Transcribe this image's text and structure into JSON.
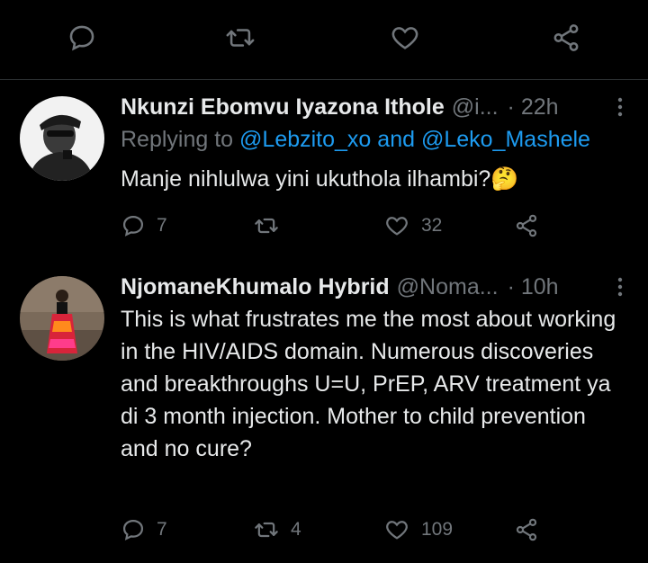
{
  "top_actions": {
    "icons": [
      "reply-icon",
      "retweet-icon",
      "like-icon",
      "share-icon"
    ]
  },
  "tweets": [
    {
      "name": "Nkunzi Ebomvu Iyazona Ithole",
      "handle": "@i...",
      "time": "· 22h",
      "replying_prefix": "Replying to",
      "replying_user1": "@Lebzito_xo",
      "replying_and": "and",
      "replying_user2": "@Leko_Mashele",
      "text": "Manje nihlulwa yini ukuthola ilhambi?🤔",
      "replies": "7",
      "retweets": "",
      "likes": "32"
    },
    {
      "name": "NjomaneKhumalo Hybrid",
      "handle": "@Noma...",
      "time": "· 10h",
      "text": "This is what frustrates me the most about working in the HIV/AIDS domain. Numerous discoveries and breakthroughs U=U, PrEP, ARV treatment ya di 3 month injection. Mother to child prevention and no cure?",
      "replies": "7",
      "retweets": "4",
      "likes": "109"
    }
  ],
  "colors": {
    "background": "#000000",
    "text": "#e7e9ea",
    "muted": "#71767b",
    "link": "#1d9bf0",
    "divider": "#2f3336"
  }
}
